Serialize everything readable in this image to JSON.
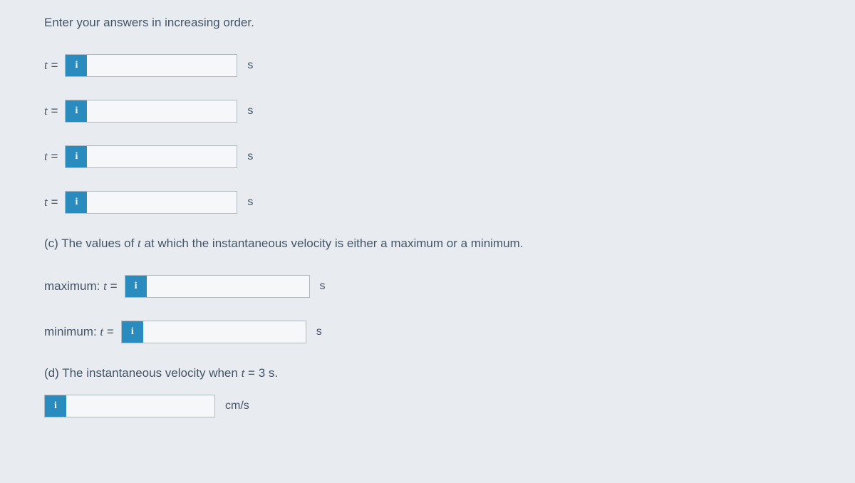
{
  "instruction": "Enter your answers in increasing order.",
  "rows_t": [
    {
      "label_pre": "t",
      "label_post": " = ",
      "unit": "s"
    },
    {
      "label_pre": "t",
      "label_post": " = ",
      "unit": "s"
    },
    {
      "label_pre": "t",
      "label_post": " = ",
      "unit": "s"
    },
    {
      "label_pre": "t",
      "label_post": " = ",
      "unit": "s"
    }
  ],
  "part_c": {
    "prefix": "(c) The values of ",
    "var": "t",
    "suffix": " at which the instantaneous velocity is either a maximum or a minimum."
  },
  "maximum": {
    "label_pre": "maximum: ",
    "var": "t",
    "label_post": " = ",
    "unit": "s"
  },
  "minimum": {
    "label_pre": "minimum: ",
    "var": "t",
    "label_post": " = ",
    "unit": "s"
  },
  "part_d": {
    "prefix": "(d) The instantaneous velocity when ",
    "var": "t",
    "mid": " = ",
    "val": "3",
    "suffix": " s."
  },
  "velocity_unit": "cm/s",
  "info_glyph": "i"
}
